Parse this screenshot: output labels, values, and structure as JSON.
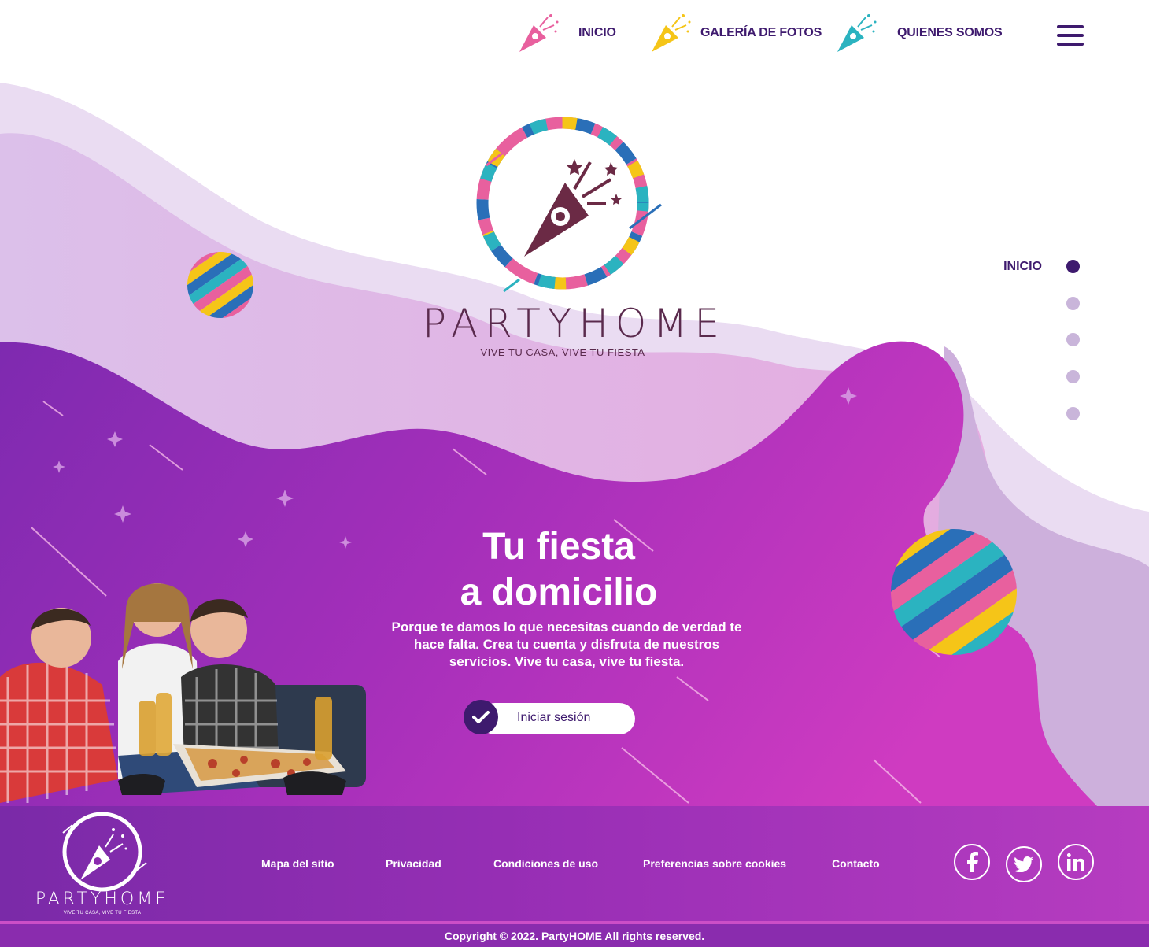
{
  "nav": {
    "items": [
      {
        "label": "INICIO",
        "icon": "party-popper-icon",
        "color": "#e8609e"
      },
      {
        "label": "GALERÍA DE FOTOS",
        "icon": "party-popper-icon",
        "color": "#f5c518"
      },
      {
        "label": "QUIENES SOMOS",
        "icon": "party-popper-icon",
        "color": "#2bb3c0"
      }
    ],
    "menu_icon": "hamburger-icon"
  },
  "brand": {
    "name": "PARTYHOME",
    "tagline": "VIVE TU CASA, VIVE TU FIESTA"
  },
  "side_nav": {
    "label": "INICIO",
    "dots": 5,
    "active_index": 0
  },
  "hero": {
    "title_line1": "Tu fiesta",
    "title_line2": "a domicilio",
    "subtitle": "Porque te damos lo que necesitas cuando de verdad te hace falta.  Crea tu cuenta y disfruta de nuestros servicios. Vive tu casa, vive tu fiesta.",
    "login_label": "Iniciar sesión"
  },
  "footer": {
    "brand_name": "PARTYHOME",
    "brand_tagline": "VIVE TU CASA, VIVE TU FIESTA",
    "links": [
      "Mapa del sitio",
      "Privacidad",
      "Condiciones de uso",
      "Preferencias sobre cookies",
      "Contacto"
    ],
    "social": [
      "facebook-icon",
      "twitter-icon",
      "linkedin-icon"
    ],
    "copyright": "Copyright © 2022. PartyHOME All rights reserved."
  },
  "colors": {
    "primary": "#3e1a6e",
    "magenta": "#c23cbf",
    "purple": "#7a2aa8",
    "pink": "#e8609e",
    "yellow": "#f5c518",
    "teal": "#2bb3c0",
    "blue": "#2a6fb8"
  }
}
